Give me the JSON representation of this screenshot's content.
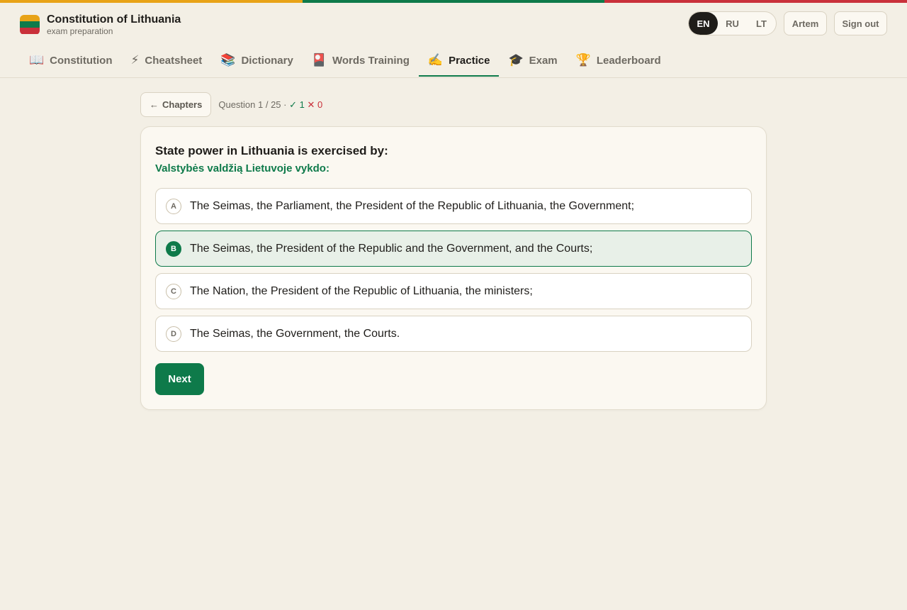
{
  "colors": {
    "flag_yellow": "#e8a317",
    "flag_green": "#0e7a4a",
    "flag_red": "#c9303a",
    "accent": "#0e7a4a"
  },
  "brand": {
    "title": "Constitution of Lithuania",
    "subtitle": "exam preparation"
  },
  "languages": [
    {
      "code": "EN",
      "active": true
    },
    {
      "code": "RU",
      "active": false
    },
    {
      "code": "LT",
      "active": false
    }
  ],
  "user": {
    "name": "Artem",
    "sign_out_label": "Sign out"
  },
  "tabs": [
    {
      "icon": "📖",
      "icon_name": "open-book-icon",
      "label": "Constitution",
      "active": false
    },
    {
      "icon": "⚡",
      "icon_name": "lightning-icon",
      "label": "Cheatsheet",
      "active": false
    },
    {
      "icon": "📚",
      "icon_name": "books-icon",
      "label": "Dictionary",
      "active": false
    },
    {
      "icon": "🎴",
      "icon_name": "flash-card-icon",
      "label": "Words Training",
      "active": false
    },
    {
      "icon": "✍️",
      "icon_name": "writing-hand-icon",
      "label": "Practice",
      "active": true
    },
    {
      "icon": "🎓",
      "icon_name": "graduation-cap-icon",
      "label": "Exam",
      "active": false
    },
    {
      "icon": "🏆",
      "icon_name": "trophy-icon",
      "label": "Leaderboard",
      "active": false
    }
  ],
  "toolbar": {
    "back_arrow": "←",
    "back_label": "Chapters",
    "progress_text": "Question 1 / 25 ·",
    "correct_mark": "✓ 1",
    "wrong_mark": "✕ 0"
  },
  "question": {
    "text_en": "State power in Lithuania is exercised by:",
    "text_lt": "Valstybės valdžią Lietuvoje vykdo:",
    "options": [
      {
        "letter": "A",
        "text": "The Seimas, the Parliament, the President of the Republic of Lithuania, the Government;",
        "selected": false
      },
      {
        "letter": "B",
        "text": "The Seimas, the President of the Republic and the Government, and the Courts;",
        "selected": true
      },
      {
        "letter": "C",
        "text": "The Nation, the President of the Republic of Lithuania, the ministers;",
        "selected": false
      },
      {
        "letter": "D",
        "text": "The Seimas, the Government, the Courts.",
        "selected": false
      }
    ],
    "next_label": "Next"
  }
}
